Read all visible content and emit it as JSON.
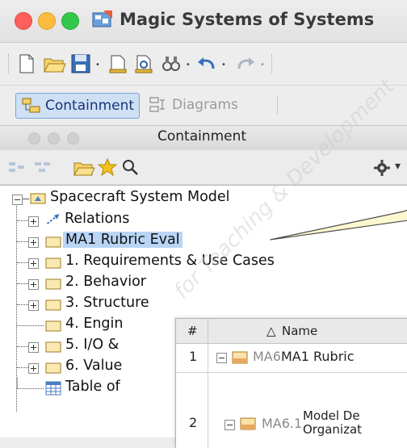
{
  "window": {
    "title": "Magic Systems of Systems"
  },
  "toolbar": {
    "icons": [
      "new-file-icon",
      "open-folder-icon",
      "save-icon",
      "document-icon",
      "print-preview-icon",
      "find-icon",
      "undo-icon",
      "redo-icon"
    ]
  },
  "tabs": [
    {
      "label": "Containment",
      "active": true
    },
    {
      "label": "Diagrams",
      "active": false
    }
  ],
  "panel": {
    "title": "Containment"
  },
  "tree": {
    "root": "Spacecraft System Model",
    "items": [
      {
        "label": "Relations",
        "kind": "relations"
      },
      {
        "label": "MA1 Rubric Eval",
        "kind": "folder",
        "selected": true
      },
      {
        "label": "1. Requirements & Use Cases",
        "kind": "folder"
      },
      {
        "label": "2. Behavior",
        "kind": "folder"
      },
      {
        "label": "3. Structure",
        "kind": "folder"
      },
      {
        "label": "4. Engin",
        "kind": "folder"
      },
      {
        "label": "5. I/O &",
        "kind": "folder"
      },
      {
        "label": "6. Value",
        "kind": "folder"
      },
      {
        "label": "Table of",
        "kind": "table"
      }
    ]
  },
  "overlay_table": {
    "columns": [
      "#",
      "Name"
    ],
    "rows": [
      {
        "num": "1",
        "id": "MA6",
        "name": "MA1 Rubric"
      },
      {
        "num": "2",
        "id": "MA6.1",
        "name_line1": "Model De",
        "name_line2": "Organizat"
      }
    ]
  },
  "watermark": "for Teaching & Development"
}
